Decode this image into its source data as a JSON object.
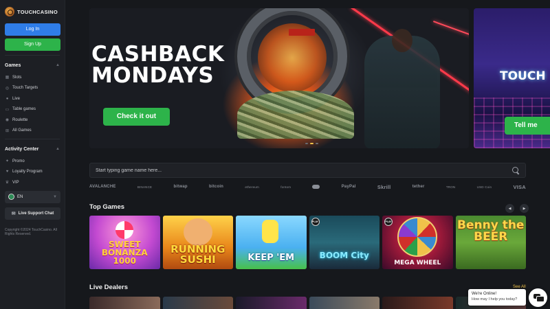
{
  "brand": {
    "name": "TOUCHCASINO"
  },
  "auth": {
    "login_label": "Log In",
    "signup_label": "Sign Up"
  },
  "sidebar": {
    "games_title": "Games",
    "games_items": [
      {
        "label": "Slots",
        "icon": "slot-icon"
      },
      {
        "label": "Touch Targets",
        "icon": "target-icon"
      },
      {
        "label": "Live",
        "icon": "live-icon"
      },
      {
        "label": "Table games",
        "icon": "cards-icon"
      },
      {
        "label": "Roulette",
        "icon": "roulette-icon"
      },
      {
        "label": "All Games",
        "icon": "grid-icon"
      }
    ],
    "activity_title": "Activity Center",
    "activity_items": [
      {
        "label": "Promo",
        "icon": "promo-icon"
      },
      {
        "label": "Loyalty Program",
        "icon": "loyalty-icon"
      },
      {
        "label": "VIP",
        "icon": "vip-icon"
      }
    ],
    "language": "EN",
    "live_support_label": "Live Support Chat",
    "copyright": "Copyright ©2024 TouchCasino. All Rights Reserved."
  },
  "banner": {
    "title_line1": "CASHBACK",
    "title_line2": "MONDAYS",
    "cta_label": "Check it out",
    "sign_text": "",
    "slide_count": 3,
    "active_slide": 2
  },
  "banner_next": {
    "title": "TOUCH",
    "cta_label": "Tell me"
  },
  "search": {
    "placeholder": "Start typing game name here..."
  },
  "payments": [
    "AVALANCHE",
    "BINANCE",
    "bitwap",
    "bitcoin",
    "ethereum",
    "fontom",
    "",
    "PayPal",
    "Skrill",
    "tether",
    "TRON",
    "USD Coin",
    "VISA"
  ],
  "top_games": {
    "title": "Top Games",
    "games": [
      {
        "name": "SWEET BONANZA 1000"
      },
      {
        "name": "RUNNING SUSHI"
      },
      {
        "name": "KEEP 'EM"
      },
      {
        "name": "BOOM City"
      },
      {
        "name": "MEGA WHEEL"
      },
      {
        "name": "Benny the BEER"
      }
    ]
  },
  "live_dealers": {
    "title": "Live Dealers",
    "see_all": "See All"
  },
  "chat": {
    "line1": "We're Online!",
    "line2": "How may I help you today?"
  },
  "colors": {
    "login": "#2f7de8",
    "signup": "#2db34a",
    "background": "#16181c",
    "sidebar": "#1d1f24",
    "accent": "#f0c24a"
  }
}
